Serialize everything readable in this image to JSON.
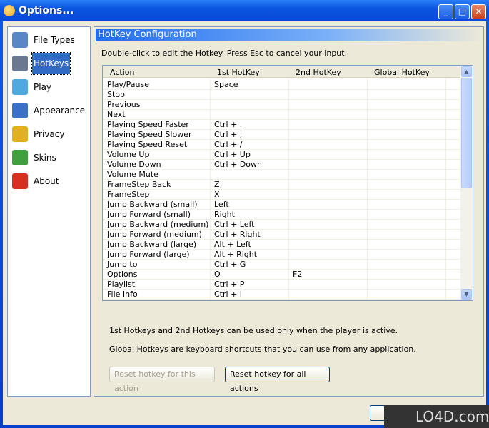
{
  "window": {
    "title": "Options..."
  },
  "sidebar": {
    "items": [
      {
        "label": "File Types",
        "icon": "file-types-icon",
        "color": "#5a86c8"
      },
      {
        "label": "HotKeys",
        "icon": "tools-icon",
        "color": "#6a7890",
        "selected": true
      },
      {
        "label": "Play",
        "icon": "monitor-icon",
        "color": "#50a8e0"
      },
      {
        "label": "Appearance",
        "icon": "appearance-icon",
        "color": "#3a70c8"
      },
      {
        "label": "Privacy",
        "icon": "lock-icon",
        "color": "#e0b020"
      },
      {
        "label": "Skins",
        "icon": "users-icon",
        "color": "#40a040"
      },
      {
        "label": "About",
        "icon": "help-icon",
        "color": "#d83020"
      }
    ]
  },
  "panel": {
    "header": "HotKey Configuration",
    "hint": "Double-click to edit the Hotkey. Press Esc to cancel your input.",
    "columns": [
      "Action",
      "1st HotKey",
      "2nd HotKey",
      "Global HotKey"
    ],
    "rows": [
      [
        "Play/Pause",
        "Space",
        "",
        ""
      ],
      [
        "Stop",
        "",
        "",
        ""
      ],
      [
        "Previous",
        "",
        "",
        ""
      ],
      [
        "Next",
        "",
        "",
        ""
      ],
      [
        "Playing Speed Faster",
        "Ctrl + .",
        "",
        ""
      ],
      [
        "Playing Speed Slower",
        "Ctrl + ,",
        "",
        ""
      ],
      [
        "Playing Speed Reset",
        "Ctrl + /",
        "",
        ""
      ],
      [
        "Volume Up",
        "Ctrl + Up",
        "",
        ""
      ],
      [
        "Volume Down",
        "Ctrl + Down",
        "",
        ""
      ],
      [
        "Volume Mute",
        "",
        "",
        ""
      ],
      [
        "FrameStep Back",
        "Z",
        "",
        ""
      ],
      [
        "FrameStep",
        "X",
        "",
        ""
      ],
      [
        "Jump Backward (small)",
        "Left",
        "",
        ""
      ],
      [
        "Jump Forward (small)",
        "Right",
        "",
        ""
      ],
      [
        "Jump Backward (medium)",
        "Ctrl + Left",
        "",
        ""
      ],
      [
        "Jump Forward (medium)",
        "Ctrl + Right",
        "",
        ""
      ],
      [
        "Jump Backward (large)",
        "Alt + Left",
        "",
        ""
      ],
      [
        "Jump Forward (large)",
        "Alt + Right",
        "",
        ""
      ],
      [
        "Jump to",
        "Ctrl + G",
        "",
        ""
      ],
      [
        "Options",
        "O",
        "F2",
        ""
      ],
      [
        "Playlist",
        "Ctrl + P",
        "",
        ""
      ],
      [
        "File Info",
        "Ctrl + I",
        "",
        ""
      ]
    ],
    "note1": "1st Hotkeys and 2nd Hotkeys can be used only when the player is active.",
    "note2": "Global Hotkeys are keyboard shortcuts that you can use from any application.",
    "reset_this": "Reset hotkey for this action",
    "reset_all": "Reset hotkey for all actions"
  },
  "watermark": "LO4D.com"
}
